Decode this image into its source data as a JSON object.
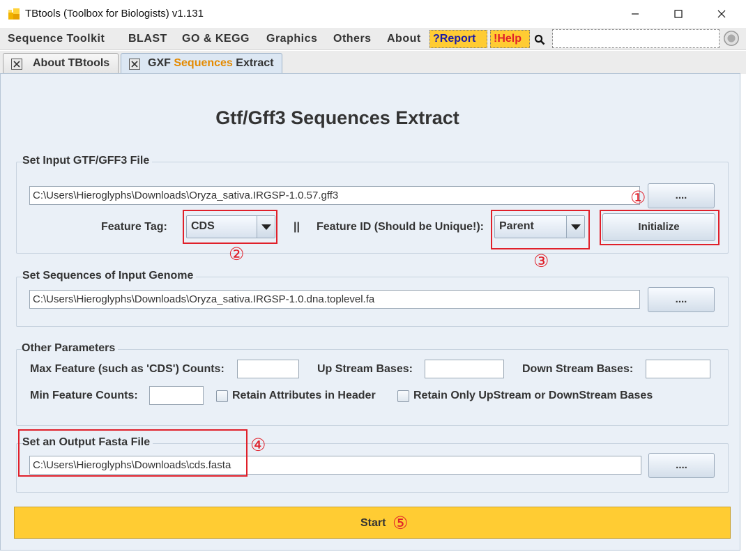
{
  "window": {
    "title": "TBtools (Toolbox for Biologists) v1.131",
    "app_icon": "tbtools-logo-icon",
    "controls": [
      "minimize-icon",
      "maximize-icon",
      "close-icon"
    ]
  },
  "menubar": {
    "items": [
      "Sequence Toolkit",
      "BLAST",
      "GO & KEGG",
      "Graphics",
      "Others",
      "About"
    ],
    "report": "?Report",
    "help": "!Help",
    "search_icon": "magnifier-icon",
    "highlight_color": "#ffcc33"
  },
  "tabs": {
    "about": "About TBtools",
    "extract_prefix": "GXF ",
    "extract_highlight": "Sequences",
    "extract_suffix": " Extract",
    "highlight_color": "#e48a00"
  },
  "main": {
    "heading": "Gtf/Gff3 Sequences Extract",
    "input_group": {
      "title": "Set Input GTF/GFF3 File",
      "file_path": "C:\\Users\\Hieroglyphs\\Downloads\\Oryza_sativa.IRGSP-1.0.57.gff3",
      "browse": "....",
      "feature_tag_label": "Feature Tag:",
      "feature_tag_value": "CDS",
      "separator": "||",
      "feature_id_label": "Feature ID (Should be Unique!):",
      "feature_id_value": "Parent",
      "initialize": "Initialize"
    },
    "genome_group": {
      "title": "Set Sequences of Input Genome",
      "file_path": "C:\\Users\\Hieroglyphs\\Downloads\\Oryza_sativa.IRGSP-1.0.dna.toplevel.fa",
      "browse": "...."
    },
    "params_group": {
      "title": "Other Parameters",
      "max_feature_label": "Max Feature (such as 'CDS') Counts:",
      "max_feature_value": "",
      "upstream_label": "Up Stream Bases:",
      "upstream_value": "",
      "downstream_label": "Down Stream Bases:",
      "downstream_value": "",
      "min_feature_label": "Min Feature Counts:",
      "min_feature_value": "",
      "retain_attributes": "Retain Attributes in Header",
      "retain_attributes_checked": false,
      "retain_updown": "Retain Only UpStream or DownStream Bases",
      "retain_updown_checked": false
    },
    "output_group": {
      "title": "Set an Output Fasta File",
      "file_path": "C:\\Users\\Hieroglyphs\\Downloads\\cds.fasta",
      "browse": "...."
    },
    "start": "Start"
  },
  "annotations": {
    "step1": "①",
    "step2": "②",
    "step3": "③",
    "step4": "④",
    "step5": "⑤",
    "color": "#e0202a"
  }
}
